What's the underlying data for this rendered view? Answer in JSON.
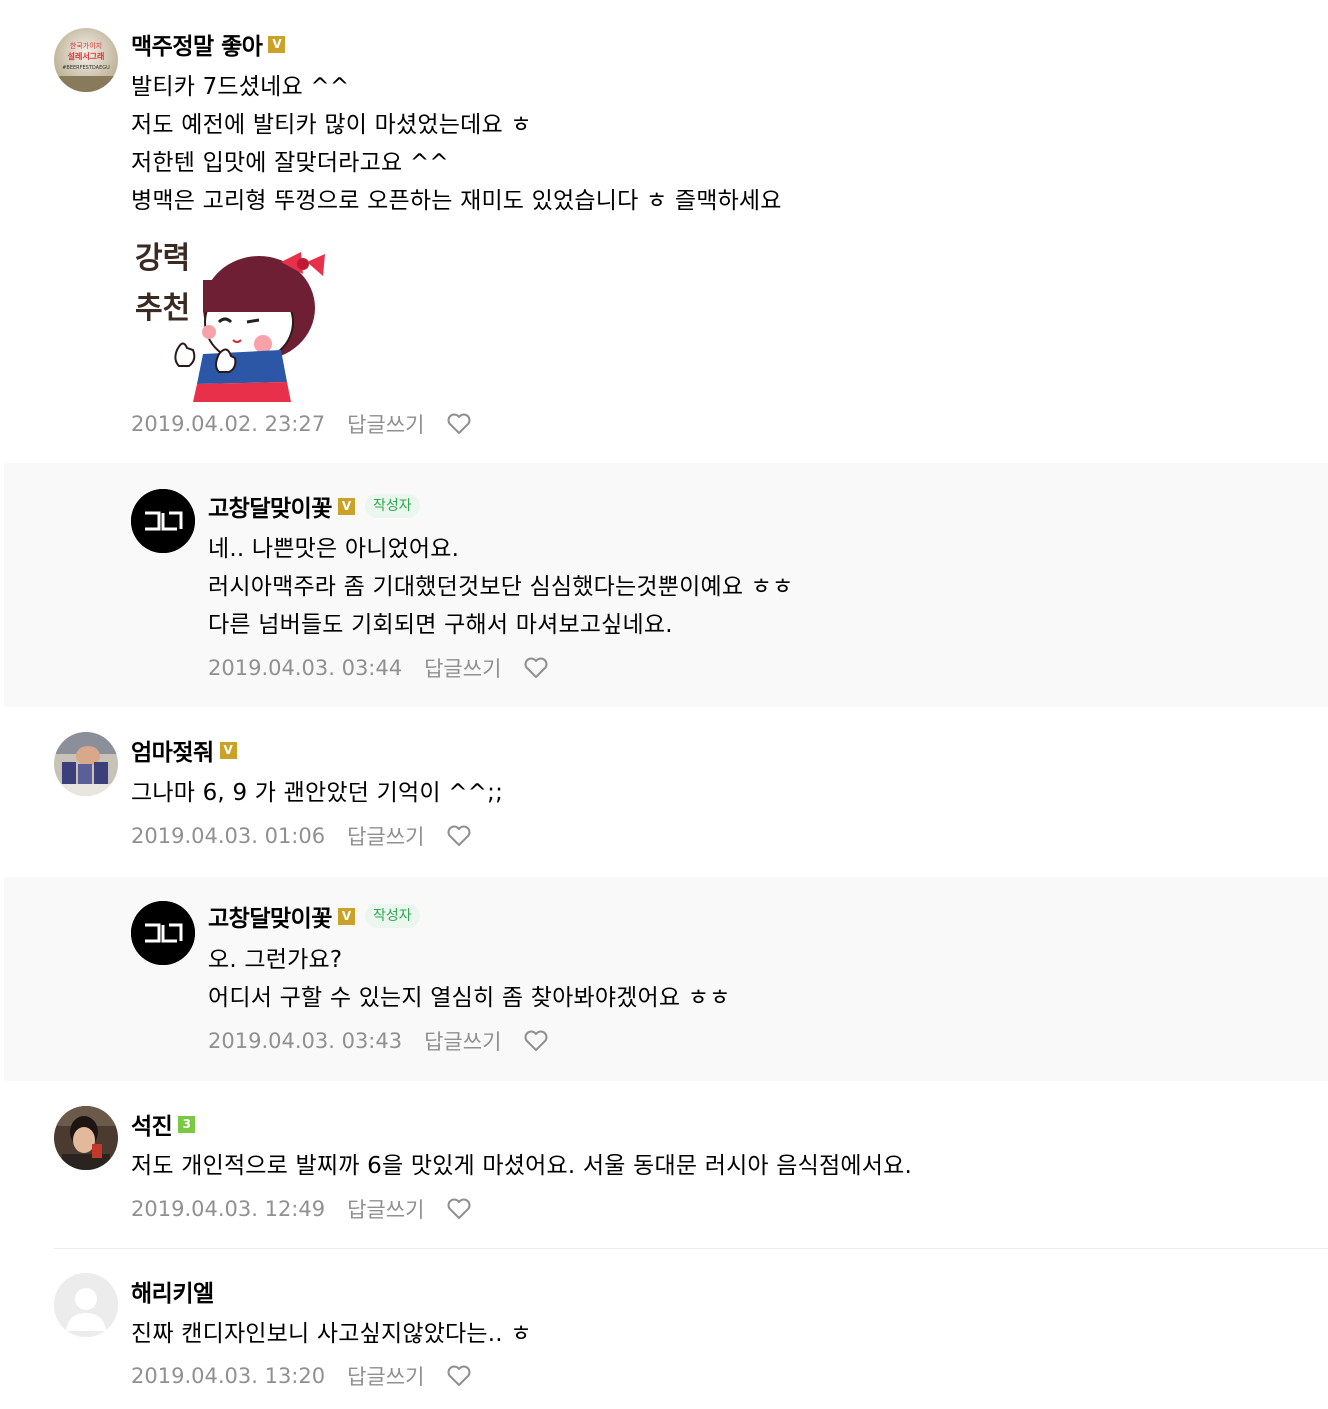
{
  "comments": [
    {
      "nickname": "맥주정말 좋아",
      "badge": "V",
      "lines": [
        "발티카 7드셨네요 ^^",
        "저도 예전에 발티카 많이 마셨었는데요 ㅎ",
        "저한텐 입맛에 잘맞더라고요 ^^",
        "병맥은 고리형 뚜껑으로 오픈하는 재미도 있었습니다 ㅎ 즐맥하세요"
      ],
      "sticker_text": [
        "강력",
        "추천"
      ],
      "date": "2019.04.02. 23:27",
      "reply_label": "답글쓰기",
      "avatar_text": [
        "한국가이지",
        "설레서그래",
        "#BEERFESTDAEGU"
      ]
    },
    {
      "nickname": "고창달맞이꽃",
      "badge": "V",
      "writer_label": "작성자",
      "lines": [
        "네.. 나쁜맛은 아니었어요.",
        "러시아맥주라 좀 기대했던것보단 심심했다는것뿐이예요 ㅎㅎ",
        "다른 넘버들도 기회되면 구해서 마셔보고싶네요."
      ],
      "date": "2019.04.03. 03:44",
      "reply_label": "답글쓰기"
    },
    {
      "nickname": "엄마젖줘",
      "badge": "V",
      "lines": [
        "그나마 6, 9 가 괜안았던 기억이 ^^;;"
      ],
      "date": "2019.04.03. 01:06",
      "reply_label": "답글쓰기"
    },
    {
      "nickname": "고창달맞이꽃",
      "badge": "V",
      "writer_label": "작성자",
      "lines": [
        "오. 그런가요?",
        "어디서 구할 수 있는지 열심히 좀 찾아봐야겠어요 ㅎㅎ"
      ],
      "date": "2019.04.03. 03:43",
      "reply_label": "답글쓰기"
    },
    {
      "nickname": "석진",
      "badge": "3",
      "lines": [
        "저도 개인적으로 발찌까 6을 맛있게 마셨어요. 서울 동대문 러시아 음식점에서요."
      ],
      "date": "2019.04.03. 12:49",
      "reply_label": "답글쓰기"
    },
    {
      "nickname": "해리키엘",
      "lines": [
        "진짜 캔디자인보니 사고싶지않았다는.. ㅎ"
      ],
      "date": "2019.04.03. 13:20",
      "reply_label": "답글쓰기"
    }
  ],
  "colors": {
    "reply_bg": "#f9f9fa",
    "meta_text": "#909090",
    "badge_v": "#c9a227",
    "badge_level": "#7ac943",
    "writer_bg": "#ebf6ee",
    "writer_text": "#2ea84d"
  },
  "icons": {
    "badge_v": "verified-badge-icon",
    "like": "heart-outline-icon",
    "default_avatar": "person-silhouette-icon"
  }
}
